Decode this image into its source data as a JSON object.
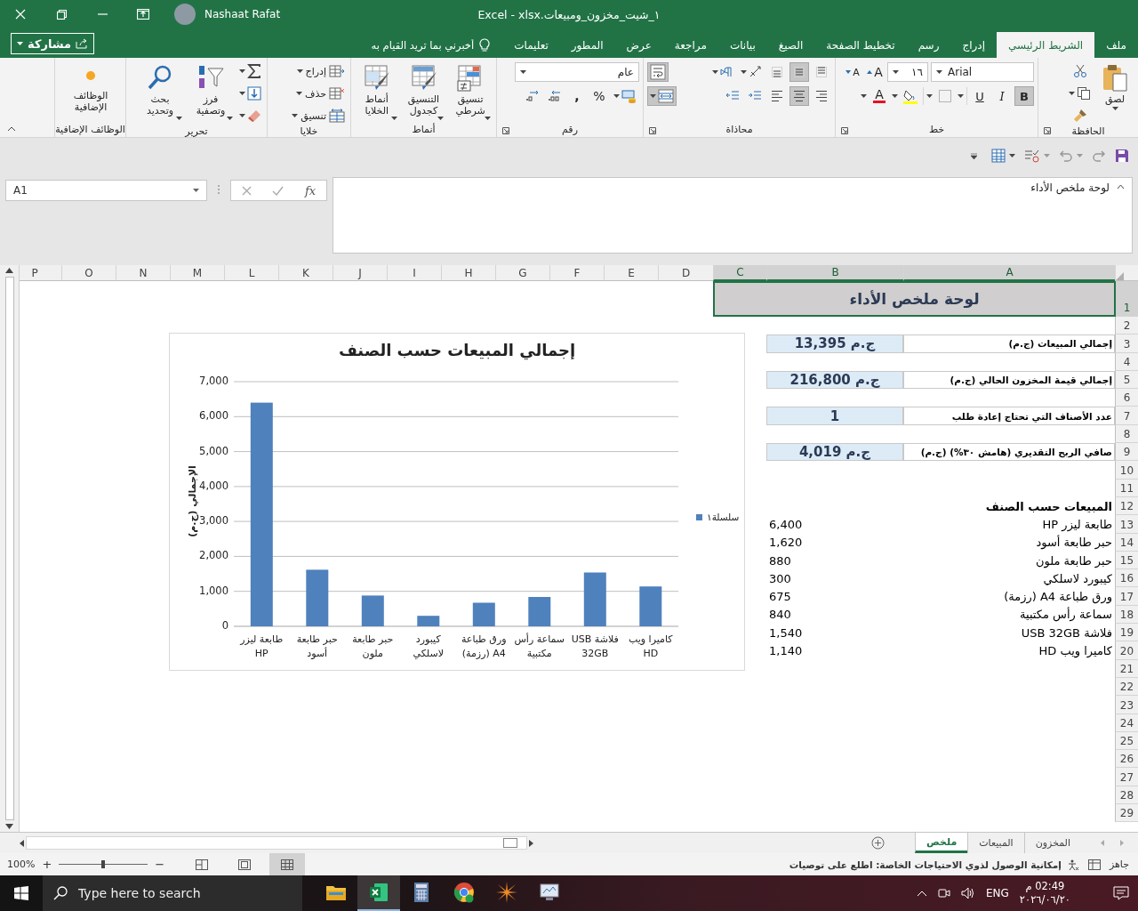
{
  "title_bar": {
    "title": "Excel  -  xlsx.١_شيت_مخزون_ومبيعات",
    "user": "Nashaat Rafat"
  },
  "menu_tabs": [
    {
      "label": "ملف",
      "selected": false
    },
    {
      "label": "الشريط الرئيسي",
      "selected": true
    },
    {
      "label": "إدراج",
      "selected": false
    },
    {
      "label": "رسم",
      "selected": false
    },
    {
      "label": "تخطيط الصفحة",
      "selected": false
    },
    {
      "label": "الصيغ",
      "selected": false
    },
    {
      "label": "بيانات",
      "selected": false
    },
    {
      "label": "مراجعة",
      "selected": false
    },
    {
      "label": "عرض",
      "selected": false
    },
    {
      "label": "المطور",
      "selected": false
    },
    {
      "label": "تعليمات",
      "selected": false
    }
  ],
  "tell_me": {
    "placeholder": "أخبرني بما تريد القيام به"
  },
  "share_button": "مشاركة",
  "ribbon": {
    "clipboard": {
      "label": "الحافظة",
      "paste": "لصق"
    },
    "font": {
      "label": "خط",
      "name": "Arial",
      "size": "١٦",
      "grow": "A",
      "shrink": "A",
      "bold": {
        "glyph": "B",
        "on": true
      },
      "italic": {
        "glyph": "I",
        "on": false
      },
      "underline": {
        "glyph": "U",
        "on": false
      },
      "color_glyph": "A"
    },
    "alignment": {
      "label": "محاذاة",
      "vertical": [
        {
          "on": false
        },
        {
          "on": true
        },
        {
          "on": false
        }
      ],
      "horizontal": [
        {
          "on": false
        },
        {
          "on": true
        },
        {
          "on": false
        }
      ],
      "wrap_text": {
        "on": true
      },
      "merge": {
        "on": true
      }
    },
    "number": {
      "label": "رقم",
      "format": "عام",
      "percent": "%",
      "comma": ","
    },
    "styles": {
      "label": "أنماط",
      "buttons": [
        "تنسيق شرطي",
        "التنسيق كجدول",
        "أنماط الخلايا"
      ]
    },
    "cells": {
      "label": "خلايا",
      "buttons": [
        "إدراج",
        "حذف",
        "تنسيق"
      ]
    },
    "editing": {
      "label": "تحرير",
      "buttons": [
        "فرز وتصفية",
        "بحث وتحديد"
      ]
    },
    "addins": {
      "label": "الوظائف الإضافية",
      "button": "الوظائف الإضافية"
    }
  },
  "formula_bar": {
    "name_box": "A1",
    "fx": "fx",
    "content": "لوحة ملخص الأداء"
  },
  "sheet": {
    "columns": [
      {
        "label": "A",
        "selected": true
      },
      {
        "label": "B",
        "selected": true
      },
      {
        "label": "C",
        "selected": true
      },
      {
        "label": "D",
        "selected": false
      },
      {
        "label": "E",
        "selected": false
      },
      {
        "label": "F",
        "selected": false
      },
      {
        "label": "G",
        "selected": false
      },
      {
        "label": "H",
        "selected": false
      },
      {
        "label": "I",
        "selected": false
      },
      {
        "label": "J",
        "selected": false
      },
      {
        "label": "K",
        "selected": false
      },
      {
        "label": "L",
        "selected": false
      },
      {
        "label": "M",
        "selected": false
      },
      {
        "label": "N",
        "selected": false
      },
      {
        "label": "O",
        "selected": false
      },
      {
        "label": "P",
        "selected": false
      }
    ],
    "rows": [
      {
        "label": "1",
        "selected": true
      },
      {
        "label": "2",
        "selected": false
      },
      {
        "label": "3",
        "selected": false
      },
      {
        "label": "4",
        "selected": false
      },
      {
        "label": "5",
        "selected": false
      },
      {
        "label": "6",
        "selected": false
      },
      {
        "label": "7",
        "selected": false
      },
      {
        "label": "8",
        "selected": false
      },
      {
        "label": "9",
        "selected": false
      },
      {
        "label": "10",
        "selected": false
      },
      {
        "label": "11",
        "selected": false
      },
      {
        "label": "12",
        "selected": false
      },
      {
        "label": "13",
        "selected": false
      },
      {
        "label": "14",
        "selected": false
      },
      {
        "label": "15",
        "selected": false
      },
      {
        "label": "16",
        "selected": false
      },
      {
        "label": "17",
        "selected": false
      },
      {
        "label": "18",
        "selected": false
      },
      {
        "label": "19",
        "selected": false
      },
      {
        "label": "20",
        "selected": false
      },
      {
        "label": "21",
        "selected": false
      },
      {
        "label": "22",
        "selected": false
      },
      {
        "label": "23",
        "selected": false
      },
      {
        "label": "24",
        "selected": false
      },
      {
        "label": "25",
        "selected": false
      },
      {
        "label": "26",
        "selected": false
      },
      {
        "label": "27",
        "selected": false
      },
      {
        "label": "28",
        "selected": false
      },
      {
        "label": "29",
        "selected": false
      }
    ],
    "title": "لوحة ملخص الأداء",
    "kpis": [
      {
        "label": "إجمالي المبيعات (ج.م)",
        "value": "ج.م 13,395"
      },
      {
        "label": "إجمالي قيمة المخزون الحالي (ج.م)",
        "value": "ج.م 216,800"
      },
      {
        "label": "عدد الأصناف التي تحتاج إعادة طلب",
        "value": "1"
      },
      {
        "label": "صافي الربح التقديري (هامش ٣٠%) (ج.م)",
        "value": "ج.م 4,019"
      }
    ],
    "sales_heading": "المبيعات حسب الصنف",
    "sales": [
      {
        "item": "طابعة ليزر HP",
        "value": "6,400"
      },
      {
        "item": "حبر طابعة أسود",
        "value": "1,620"
      },
      {
        "item": "حبر طابعة ملون",
        "value": "880"
      },
      {
        "item": "كيبورد لاسلكي",
        "value": "300"
      },
      {
        "item": "ورق طباعة A4 (رزمة)",
        "value": "675"
      },
      {
        "item": "سماعة رأس مكتبية",
        "value": "840"
      },
      {
        "item": "فلاشة USB 32GB",
        "value": "1,540"
      },
      {
        "item": "كاميرا ويب HD",
        "value": "1,140"
      }
    ]
  },
  "chart": {
    "chart_data": {
      "type": "bar",
      "title": "إجمالي المبيعات حسب الصنف",
      "ylabel": "الإجمالي (ج.م)",
      "categories": [
        "طابعة ليزر HP",
        "حبر طابعة أسود",
        "حبر طابعة ملون",
        "كيبورد لاسلكي",
        "ورق طباعة A4 (رزمة)",
        "سماعة رأس مكتبية",
        "فلاشة USB 32GB",
        "كاميرا ويب HD"
      ],
      "series": [
        {
          "name": "سلسلة١",
          "color": "#4f81bd",
          "values": [
            6400,
            1620,
            880,
            300,
            675,
            840,
            1540,
            1140
          ]
        }
      ],
      "ylim": [
        0,
        7000
      ],
      "grid": true,
      "yticks": [
        {
          "value": 0,
          "label": "0"
        },
        {
          "value": 1000,
          "label": "1,000"
        },
        {
          "value": 2000,
          "label": "2,000"
        },
        {
          "value": 3000,
          "label": "3,000"
        },
        {
          "value": 4000,
          "label": "4,000"
        },
        {
          "value": 5000,
          "label": "5,000"
        },
        {
          "value": 6000,
          "label": "6,000"
        },
        {
          "value": 7000,
          "label": "7,000"
        }
      ]
    }
  },
  "sheet_tabs": [
    {
      "label": "المخزون",
      "selected": false
    },
    {
      "label": "المبيعات",
      "selected": false
    },
    {
      "label": "ملخص",
      "selected": true
    }
  ],
  "status_bar": {
    "mode": "جاهز",
    "accessibility": "إمكانية الوصول لذوي الاحتياجات الخاصة: اطلع على توصيات",
    "views": [
      {
        "selected": true
      },
      {
        "selected": false
      },
      {
        "selected": false
      }
    ],
    "zoom_out": "−",
    "zoom_slider": {
      "level": 0.5
    },
    "zoom_in": "+",
    "zoom": "100%"
  },
  "taskbar": {
    "search": {
      "placeholder": "Type here to search"
    },
    "apps": [
      {
        "kind": "folder",
        "active": false
      },
      {
        "kind": "spreadsheet",
        "active": true
      },
      {
        "kind": "calculator",
        "active": false
      },
      {
        "kind": "browser",
        "active": false
      },
      {
        "kind": "starburst",
        "active": false
      },
      {
        "kind": "monitor",
        "active": false
      }
    ],
    "language": "ENG",
    "time": "02:49 م",
    "date": "٢٠٢٦/٠٦/٢٠"
  }
}
